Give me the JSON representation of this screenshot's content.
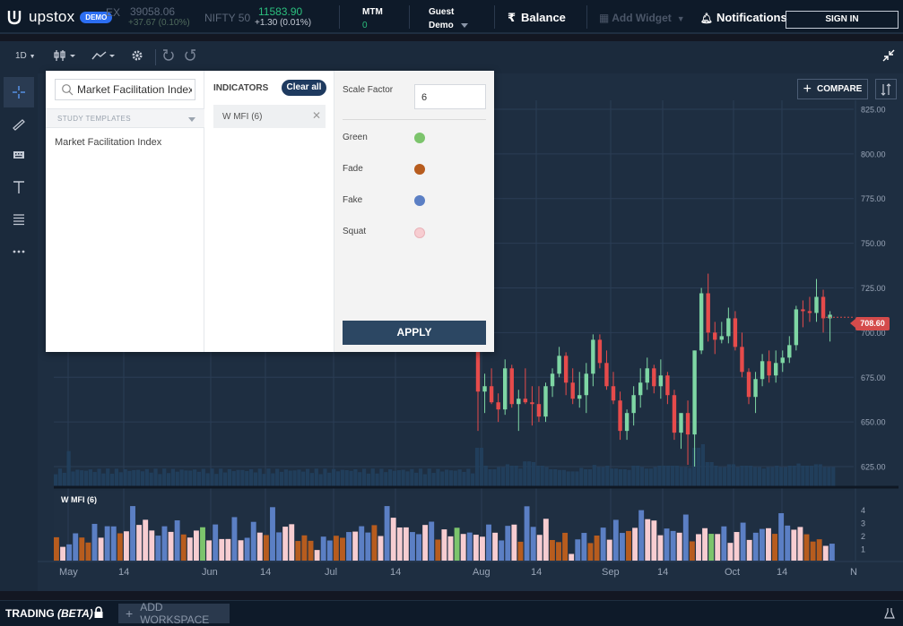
{
  "header": {
    "logo_text": "upstox",
    "demo_badge": "DEMO",
    "sensex": {
      "name": "EX",
      "value": "39058.06",
      "change": "+37.67 (0.10%)"
    },
    "nifty": {
      "name": "NIFTY 50",
      "value": "11583.90",
      "change": "+1.30 (0.01%)"
    },
    "mtm_label": "MTM",
    "mtm_value": "0",
    "guest_label": "Guest",
    "guest_name": "Demo",
    "balance_label": "Balance",
    "add_widget_label": "Add Widget",
    "notifications_label": "Notifications",
    "sign_in_label": "SIGN IN"
  },
  "toolbar": {
    "interval": "1D",
    "icons": [
      "candle-type-icon",
      "draw-line-icon",
      "settings-icon",
      "undo-icon",
      "redo-icon",
      "collapse-icon"
    ]
  },
  "left_tools": [
    "crosshair-icon",
    "pencil-icon",
    "keyboard-icon",
    "text-icon",
    "lines-icon",
    "more-icon"
  ],
  "chart": {
    "compare_label": "COMPARE",
    "last_price": "708.60",
    "sub_indicator_label": "W MFI (6)"
  },
  "indicator_panel": {
    "search_value": "Market Facilitation Index",
    "study_templates_label": "STUDY TEMPLATES",
    "study_results": [
      "Market Facilitation Index"
    ],
    "indicators_label": "INDICATORS",
    "clear_all_label": "Clear all",
    "active_indicators": [
      "W MFI (6)"
    ],
    "scale_factor_label": "Scale Factor",
    "scale_factor_value": "6",
    "colors": [
      {
        "label": "Green",
        "color": "#7cc46c"
      },
      {
        "label": "Fade",
        "color": "#b75c1e"
      },
      {
        "label": "Fake",
        "color": "#5b7fc4"
      },
      {
        "label": "Squat",
        "color": "#f7cdd1"
      }
    ],
    "apply_label": "APPLY"
  },
  "footer": {
    "trading_label": "TRADING",
    "beta_label": "(BETA)",
    "add_workspace_label": "ADD WORKSPACE"
  },
  "chart_data": {
    "type": "candlestick",
    "y_axis": {
      "ticks": [
        "825.00",
        "800.00",
        "775.00",
        "750.00",
        "725.00",
        "700.00",
        "675.00",
        "650.00",
        "625.00"
      ],
      "min": 615,
      "max": 835
    },
    "x_axis": {
      "ticks": [
        "May",
        "14",
        "Jun",
        "14",
        "Jul",
        "14",
        "Aug",
        "14",
        "Sep",
        "14",
        "Oct",
        "14",
        "N"
      ]
    },
    "sub_y_axis": {
      "ticks": [
        "4",
        "3",
        "2",
        "1"
      ]
    },
    "colors": {
      "up": "#7ed6a4",
      "down": "#e64b4b",
      "volume": "#21405e"
    },
    "candles": [
      {
        "o": 697,
        "h": 703,
        "l": 645,
        "c": 667
      },
      {
        "o": 667,
        "h": 677,
        "l": 655,
        "c": 670
      },
      {
        "o": 670,
        "h": 680,
        "l": 660,
        "c": 661
      },
      {
        "o": 661,
        "h": 666,
        "l": 650,
        "c": 657
      },
      {
        "o": 657,
        "h": 685,
        "l": 654,
        "c": 680
      },
      {
        "o": 680,
        "h": 682,
        "l": 658,
        "c": 660
      },
      {
        "o": 660,
        "h": 668,
        "l": 645,
        "c": 663
      },
      {
        "o": 663,
        "h": 680,
        "l": 660,
        "c": 661
      },
      {
        "o": 661,
        "h": 670,
        "l": 648,
        "c": 660
      },
      {
        "o": 660,
        "h": 670,
        "l": 650,
        "c": 653
      },
      {
        "o": 653,
        "h": 672,
        "l": 650,
        "c": 670
      },
      {
        "o": 670,
        "h": 680,
        "l": 664,
        "c": 677
      },
      {
        "o": 677,
        "h": 692,
        "l": 675,
        "c": 687
      },
      {
        "o": 687,
        "h": 689,
        "l": 665,
        "c": 672
      },
      {
        "o": 672,
        "h": 680,
        "l": 660,
        "c": 663
      },
      {
        "o": 663,
        "h": 678,
        "l": 658,
        "c": 665
      },
      {
        "o": 665,
        "h": 683,
        "l": 655,
        "c": 677
      },
      {
        "o": 677,
        "h": 699,
        "l": 670,
        "c": 696
      },
      {
        "o": 696,
        "h": 699,
        "l": 680,
        "c": 683
      },
      {
        "o": 683,
        "h": 690,
        "l": 668,
        "c": 670
      },
      {
        "o": 670,
        "h": 678,
        "l": 660,
        "c": 662
      },
      {
        "o": 662,
        "h": 667,
        "l": 640,
        "c": 645
      },
      {
        "o": 645,
        "h": 657,
        "l": 640,
        "c": 655
      },
      {
        "o": 655,
        "h": 670,
        "l": 648,
        "c": 665
      },
      {
        "o": 665,
        "h": 680,
        "l": 658,
        "c": 672
      },
      {
        "o": 672,
        "h": 686,
        "l": 668,
        "c": 680
      },
      {
        "o": 680,
        "h": 682,
        "l": 666,
        "c": 670
      },
      {
        "o": 670,
        "h": 685,
        "l": 663,
        "c": 676
      },
      {
        "o": 676,
        "h": 678,
        "l": 660,
        "c": 665
      },
      {
        "o": 665,
        "h": 668,
        "l": 640,
        "c": 644
      },
      {
        "o": 644,
        "h": 652,
        "l": 635,
        "c": 655
      },
      {
        "o": 655,
        "h": 662,
        "l": 626,
        "c": 643
      },
      {
        "o": 643,
        "h": 690,
        "l": 625,
        "c": 690
      },
      {
        "o": 690,
        "h": 725,
        "l": 688,
        "c": 722
      },
      {
        "o": 722,
        "h": 733,
        "l": 695,
        "c": 700
      },
      {
        "o": 700,
        "h": 706,
        "l": 688,
        "c": 696
      },
      {
        "o": 696,
        "h": 706,
        "l": 694,
        "c": 698
      },
      {
        "o": 698,
        "h": 714,
        "l": 694,
        "c": 708
      },
      {
        "o": 708,
        "h": 712,
        "l": 690,
        "c": 692
      },
      {
        "o": 692,
        "h": 700,
        "l": 675,
        "c": 678
      },
      {
        "o": 678,
        "h": 680,
        "l": 660,
        "c": 664
      },
      {
        "o": 664,
        "h": 678,
        "l": 655,
        "c": 674
      },
      {
        "o": 674,
        "h": 688,
        "l": 670,
        "c": 684
      },
      {
        "o": 684,
        "h": 690,
        "l": 672,
        "c": 676
      },
      {
        "o": 676,
        "h": 690,
        "l": 672,
        "c": 683
      },
      {
        "o": 683,
        "h": 690,
        "l": 678,
        "c": 686
      },
      {
        "o": 686,
        "h": 698,
        "l": 683,
        "c": 693
      },
      {
        "o": 693,
        "h": 715,
        "l": 690,
        "c": 713
      },
      {
        "o": 713,
        "h": 718,
        "l": 703,
        "c": 712
      },
      {
        "o": 712,
        "h": 720,
        "l": 706,
        "c": 711
      },
      {
        "o": 711,
        "h": 730,
        "l": 706,
        "c": 720
      },
      {
        "o": 720,
        "h": 724,
        "l": 700,
        "c": 708
      },
      {
        "o": 708,
        "h": 712,
        "l": 695,
        "c": 710
      }
    ],
    "volumes": [
      0.55,
      0.3,
      0.25,
      0.28,
      0.32,
      0.3,
      0.26,
      0.36,
      0.35,
      0.3,
      0.28,
      0.25,
      0.24,
      0.22,
      0.22,
      0.27,
      0.25,
      0.31,
      0.28,
      0.3,
      0.26,
      0.25,
      0.24,
      0.3,
      0.28,
      0.26,
      0.28,
      0.3,
      0.3,
      0.3,
      0.28,
      0.27,
      0.55,
      0.6,
      0.35,
      0.3,
      0.28,
      0.32,
      0.28,
      0.3,
      0.3,
      0.28,
      0.26,
      0.28,
      0.3,
      0.28,
      0.3,
      0.33,
      0.3,
      0.3,
      0.32,
      0.28,
      0.28
    ],
    "mfi_bars": [
      {
        "v": 1.8,
        "t": "fade"
      },
      {
        "v": 0.8,
        "t": "squat"
      },
      {
        "v": 1.6,
        "t": "fake"
      },
      {
        "v": 1.9,
        "t": "fake"
      },
      {
        "v": 1.7,
        "t": "fade"
      },
      {
        "v": 1.7,
        "t": "fade"
      },
      {
        "v": 2.5,
        "t": "fake"
      },
      {
        "v": 1.9,
        "t": "squat"
      },
      {
        "v": 2.8,
        "t": "fake"
      },
      {
        "v": 2.3,
        "t": "fake"
      },
      {
        "v": 2.4,
        "t": "fade"
      },
      {
        "v": 2.2,
        "t": "squat"
      },
      {
        "v": 4.2,
        "t": "fake"
      },
      {
        "v": 3.1,
        "t": "squat"
      },
      {
        "v": 2.9,
        "t": "squat"
      },
      {
        "v": 2.3,
        "t": "squat"
      },
      {
        "v": 2.2,
        "t": "fake"
      },
      {
        "v": 2.3,
        "t": "fake"
      },
      {
        "v": 2.4,
        "t": "squat"
      },
      {
        "v": 3.2,
        "t": "fake"
      },
      {
        "v": 1.7,
        "t": "fade"
      },
      {
        "v": 2.1,
        "t": "squat"
      },
      {
        "v": 2.2,
        "t": "squat"
      },
      {
        "v": 2.4,
        "t": "green"
      },
      {
        "v": 1.9,
        "t": "squat"
      },
      {
        "v": 2.5,
        "t": "fake"
      },
      {
        "v": 1.7,
        "t": "squat"
      },
      {
        "v": 1.9,
        "t": "squat"
      },
      {
        "v": 3.0,
        "t": "fake"
      },
      {
        "v": 1.8,
        "t": "squat"
      },
      {
        "v": 1.8,
        "t": "fake"
      },
      {
        "v": 2.7,
        "t": "fake"
      },
      {
        "v": 2.5,
        "t": "squat"
      },
      {
        "v": 1.8,
        "t": "fade"
      },
      {
        "v": 4.0,
        "t": "fake"
      },
      {
        "v": 2.5,
        "t": "fake"
      },
      {
        "v": 2.3,
        "t": "squat"
      },
      {
        "v": 2.9,
        "t": "squat"
      },
      {
        "v": 1.7,
        "t": "fade"
      },
      {
        "v": 1.6,
        "t": "fade"
      }
    ]
  }
}
